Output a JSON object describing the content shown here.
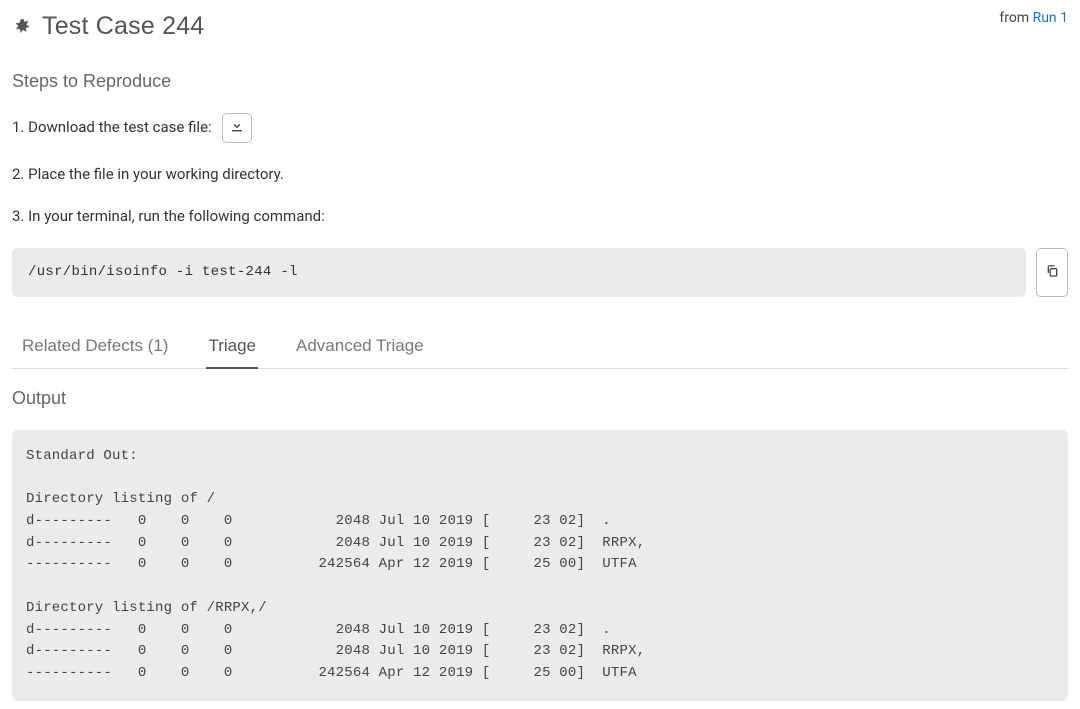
{
  "header": {
    "title": "Test Case 244",
    "from_prefix": "from ",
    "run_link_text": "Run 1"
  },
  "steps": {
    "heading": "Steps to Reproduce",
    "items": [
      "1. Download the test case file:",
      "2. Place the file in your working directory.",
      "3. In your terminal, run the following command:"
    ]
  },
  "command": "/usr/bin/isoinfo -i test-244 -l",
  "tabs": {
    "related_defects": "Related Defects (1)",
    "triage": "Triage",
    "advanced_triage": "Advanced Triage"
  },
  "output": {
    "heading": "Output",
    "text": "Standard Out:\n\nDirectory listing of /\nd---------   0    0    0            2048 Jul 10 2019 [     23 02]  .\nd---------   0    0    0            2048 Jul 10 2019 [     23 02]  RRPX,\n----------   0    0    0          242564 Apr 12 2019 [     25 00]  UTFA\n\nDirectory listing of /RRPX,/\nd---------   0    0    0            2048 Jul 10 2019 [     23 02]  .\nd---------   0    0    0            2048 Jul 10 2019 [     23 02]  RRPX,\n----------   0    0    0          242564 Apr 12 2019 [     25 00]  UTFA"
  }
}
